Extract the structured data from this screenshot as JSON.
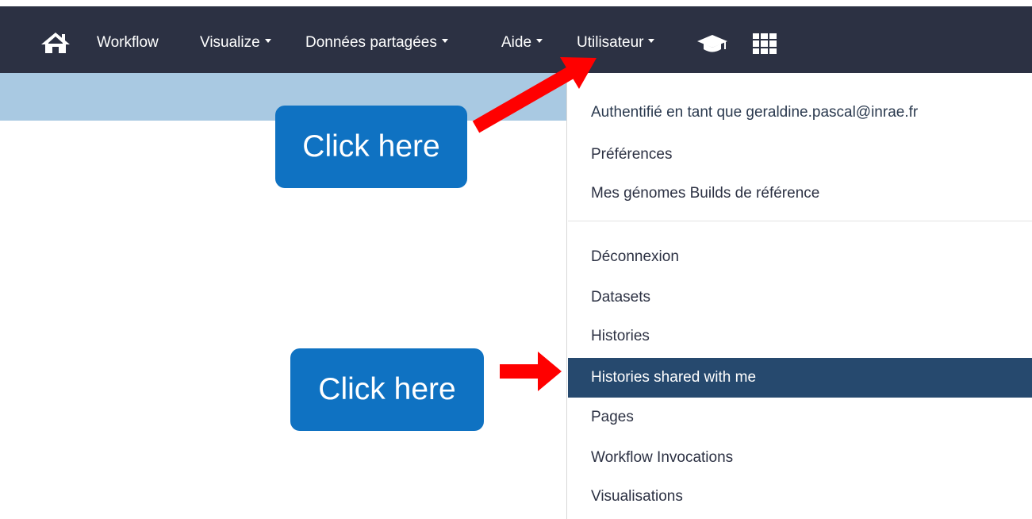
{
  "navbar": {
    "home_icon": "home-icon",
    "items": [
      {
        "label": "Workflow",
        "has_caret": false
      },
      {
        "label": "Visualize",
        "has_caret": true
      },
      {
        "label": "Données partagées",
        "has_caret": true
      },
      {
        "label": "Aide",
        "has_caret": true
      },
      {
        "label": "Utilisateur",
        "has_caret": true
      }
    ],
    "icons": [
      "graduation-cap-icon",
      "grid-icon"
    ],
    "background": "#2c3143",
    "text_color": "#ffffff"
  },
  "subbar": {
    "color": "#a9c9e2"
  },
  "dropdown": {
    "header": "Authentifié en tant que geraldine.pascal@inrae.fr",
    "items_top": [
      "Préférences",
      "Mes génomes Builds de référence"
    ],
    "items_bottom": [
      "Déconnexion",
      "Datasets",
      "Histories",
      "Histories shared with me",
      "Pages",
      "Workflow Invocations",
      "Visualisations"
    ],
    "active_item": "Histories shared with me",
    "active_color": "#26496e"
  },
  "annotations": {
    "callout_top": "Click here",
    "callout_bottom": "Click here",
    "callout_color": "#0f72c2",
    "arrow_color": "#ff0000"
  }
}
